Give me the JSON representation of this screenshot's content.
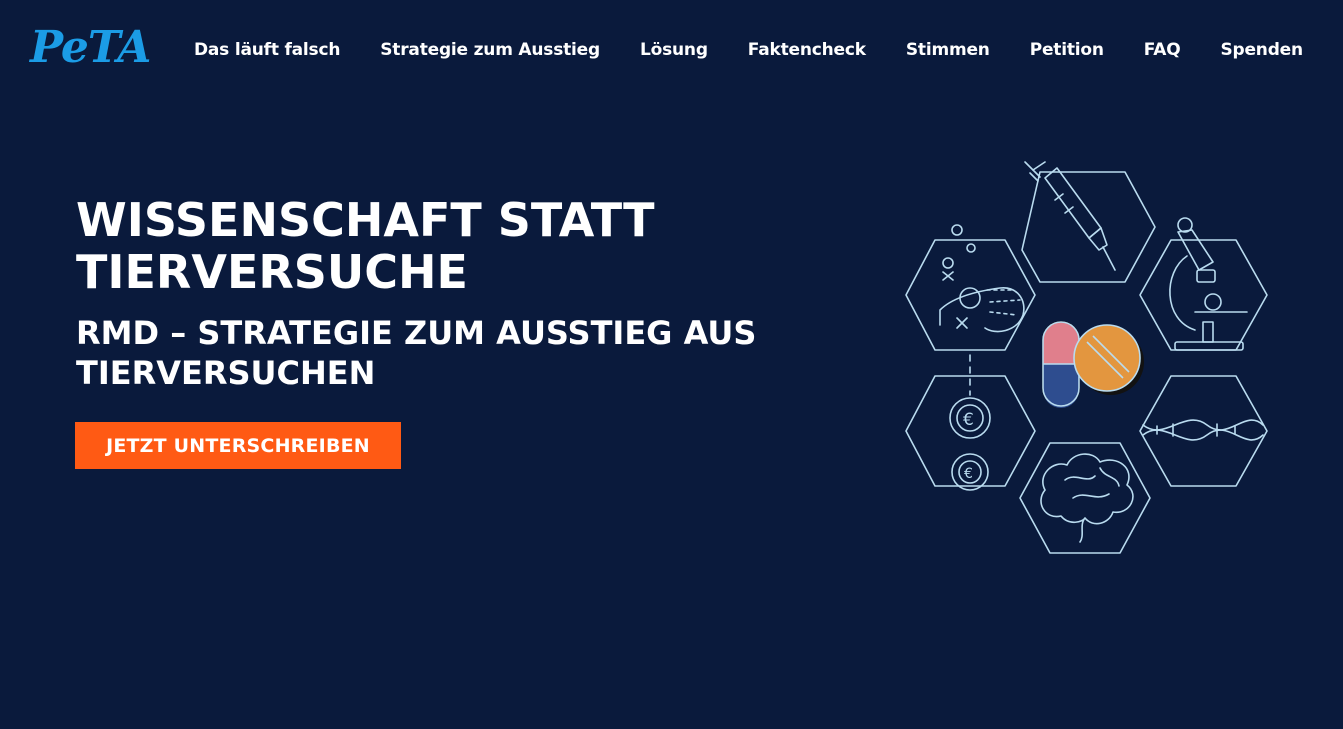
{
  "header": {
    "logo_text": "PeTA",
    "nav": [
      {
        "label": "Das läuft falsch"
      },
      {
        "label": "Strategie zum Ausstieg"
      },
      {
        "label": "Lösung"
      },
      {
        "label": "Faktencheck"
      },
      {
        "label": "Stimmen"
      },
      {
        "label": "Petition"
      },
      {
        "label": "FAQ"
      },
      {
        "label": "Spenden"
      }
    ]
  },
  "hero": {
    "title": "WISSENSCHAFT STATT TIERVERSUCHE",
    "subtitle": "RMD – STRATEGIE ZUM AUSSTIEG AUS TIERVERSUCHEN",
    "cta_label": "JETZT UNTERSCHREIBEN"
  },
  "illustration": {
    "icons": [
      "syringe-icon",
      "microscope-icon",
      "dna-icon",
      "brain-icon",
      "euro-coin-icon",
      "lab-mouse-icon",
      "pills-icon"
    ]
  },
  "colors": {
    "background": "#0a1a3c",
    "logo": "#1b9ce6",
    "cta": "#ff5a14",
    "line_art": "#b9dbef",
    "pill_pink": "#e07f8c",
    "pill_blue": "#2e4d8f",
    "tablet_orange": "#e3963f"
  }
}
